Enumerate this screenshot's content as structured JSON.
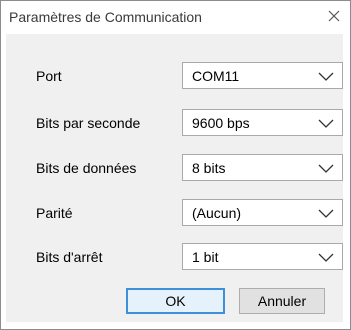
{
  "window": {
    "title": "Paramètres de Communication"
  },
  "fields": [
    {
      "label": "Port",
      "value": "COM11"
    },
    {
      "label": "Bits par seconde",
      "value": "9600 bps"
    },
    {
      "label": "Bits de données",
      "value": "8 bits"
    },
    {
      "label": "Parité",
      "value": "(Aucun)"
    },
    {
      "label": "Bits d'arrêt",
      "value": "1 bit"
    }
  ],
  "buttons": {
    "ok": "OK",
    "cancel": "Annuler"
  },
  "colors": {
    "client_bg": "#f0f0f0",
    "default_button_border": "#3c8fd8"
  },
  "icons": {
    "close": "close-icon",
    "dropdown": "chevron-down-icon"
  }
}
